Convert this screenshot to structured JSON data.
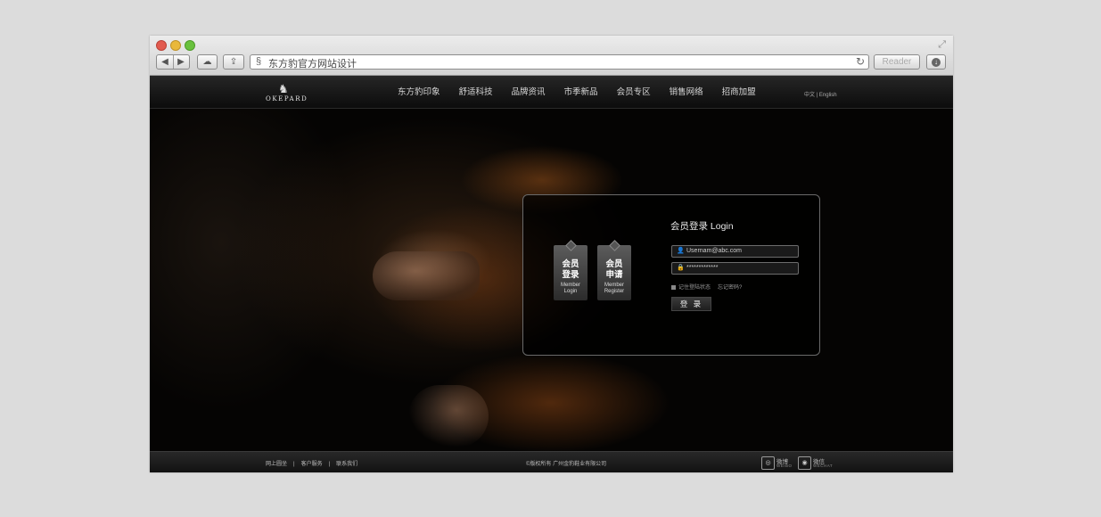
{
  "browser": {
    "url_text": "东方豹官方网站设计",
    "reader_label": "Reader",
    "nav_back": "◀",
    "nav_forward": "▶",
    "cloud_icon": "☁",
    "share_icon": "⇪",
    "reload_icon": "↻",
    "download_icon": "↓",
    "expand_icon": "⤢",
    "favicon": "§"
  },
  "site": {
    "logo": {
      "mark": "♞",
      "wordmark": "OKEPARD"
    },
    "nav": [
      {
        "label": "东方豹印象"
      },
      {
        "label": "舒适科技"
      },
      {
        "label": "品牌资讯"
      },
      {
        "label": "市季新品"
      },
      {
        "label": "会员专区"
      },
      {
        "label": "销售网络"
      },
      {
        "label": "招商加盟"
      }
    ],
    "lang_switch": "中文 | English",
    "login": {
      "title": "会员登录 Login",
      "username_icon": "👤",
      "password_icon": "🔒",
      "username_value": "Usernam@abc.com",
      "password_value": "*************",
      "remember_label": "记住登陆状态",
      "forgot_label": "忘记密码?",
      "submit_label": "登 录",
      "tags": [
        {
          "zh": "会员\n登录",
          "en": "Member\nLogin"
        },
        {
          "zh": "会员\n申请",
          "en": "Member\nRegister"
        }
      ]
    },
    "footer": {
      "links": [
        "网上圆坐",
        "客户服务",
        "联系我们"
      ],
      "copyright": "©版权所有  广州金豹鞋业有限公司",
      "social": [
        {
          "name": "微博",
          "en": "WEIBO",
          "icon": "◎"
        },
        {
          "name": "微信",
          "en": "WECHAT",
          "icon": "◉"
        }
      ]
    }
  },
  "colors": {
    "page_bg": "#dcdcdc",
    "site_bg": "#000000",
    "leather_accent": "#8a4a1a"
  }
}
